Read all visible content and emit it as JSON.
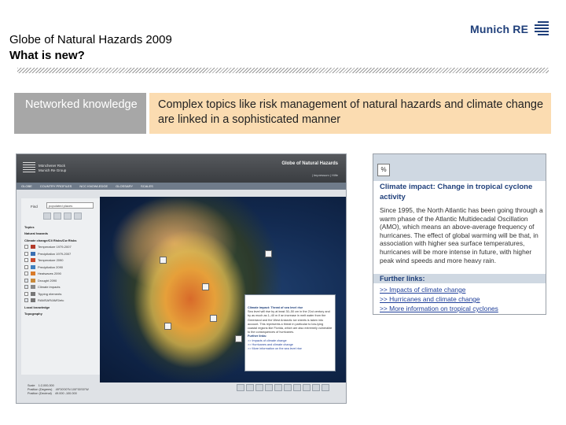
{
  "slide": {
    "title_line1": "Globe of Natural Hazards 2009",
    "title_line2": "What is new?",
    "brand": "Munich RE",
    "box_left": "Networked knowledge",
    "box_right": "Complex topics like risk management of natural hazards and climate change are linked in a sophisticated manner"
  },
  "colors": {
    "brand_blue": "#1f3f7a",
    "box_left_bg": "#a7a7a7",
    "box_right_bg": "#fbdcb1"
  },
  "app": {
    "brand_line1": "Münchener Rück",
    "brand_line2": "Munich Re Group",
    "title": "Globe of Natural Hazards",
    "header_links": "| Impressum   | Hilfe",
    "nav": [
      "GLOBE",
      "COUNTRY PROFILES",
      "NCC KNOWLEDGE",
      "GLOSSARY",
      "SCALES"
    ],
    "find_label": "Find",
    "find_placeholder": "populated places",
    "tree": [
      {
        "label": "Topics",
        "kind": "section"
      },
      {
        "label": "Natural hazards",
        "kind": "section"
      },
      {
        "label": "Climate change/Cli Risks/Cw Risks",
        "kind": "section"
      },
      {
        "label": "Temperature 1979-2007",
        "kind": "item",
        "swatch": "#b23a2a"
      },
      {
        "label": "Precipitation 1979-2007",
        "kind": "item",
        "swatch": "#3a6fb2"
      },
      {
        "label": "Temperature 2090",
        "kind": "item",
        "swatch": "#c9492b"
      },
      {
        "label": "Precipitation 2090",
        "kind": "item",
        "swatch": "#3f7fbf"
      },
      {
        "label": "Heatwaves 2090",
        "kind": "item",
        "swatch": "#d97b2a"
      },
      {
        "label": "Drought 2090",
        "kind": "item",
        "swatch": "#c98a3a"
      },
      {
        "label": "Climate impacts",
        "kind": "item",
        "swatch": "#888888"
      },
      {
        "label": "Tipping elements",
        "kind": "item",
        "swatch": "#777777"
      },
      {
        "label": "RAMSAR/AMS/etc",
        "kind": "item",
        "swatch": "#777777"
      },
      {
        "label": "Local knowledge",
        "kind": "section"
      },
      {
        "label": "Topography",
        "kind": "section"
      }
    ],
    "popup": {
      "title": "Climate impact: Threat of sea level rise",
      "body": "Sea level will rise by at least 30–50 cm in the 21st century and by as much as 1–40 m if an increase in melt water from the Greenland and the West Antarctic ice sheets is taken into account. This represents a threat in particular to low-lying coastal regions like Florida, which are also extremely vulnerable to the consequences of hurricanes.",
      "links_title": "Further links:",
      "links": [
        ">> Impacts of climate change",
        ">> Hurricanes and climate change",
        ">> More information on the sea level rise"
      ]
    },
    "footer": "Scale    1:2,000,000\nPosition (Degrees)    49°00'00\"N 100°00'00\"W\nPosition (Decimal)    49.000 -100.000"
  },
  "zoom": {
    "header_icon": "%",
    "title": "Climate impact: Change in tropical cyclone activity",
    "body": "Since 1995, the North Atlantic has been going through a warm phase of the Atlantic Multidecadal Oscillation (AMO), which means an above-average frequency of hurricanes. The effect of global warming will be that, in association with higher sea surface temperatures, hurricanes will be more intense in future, with higher peak wind speeds and more heavy rain.",
    "links_title": "Further links:",
    "links": [
      ">> Impacts of climate change",
      ">> Hurricanes and climate change",
      ">> More information on tropical cyclones"
    ]
  }
}
